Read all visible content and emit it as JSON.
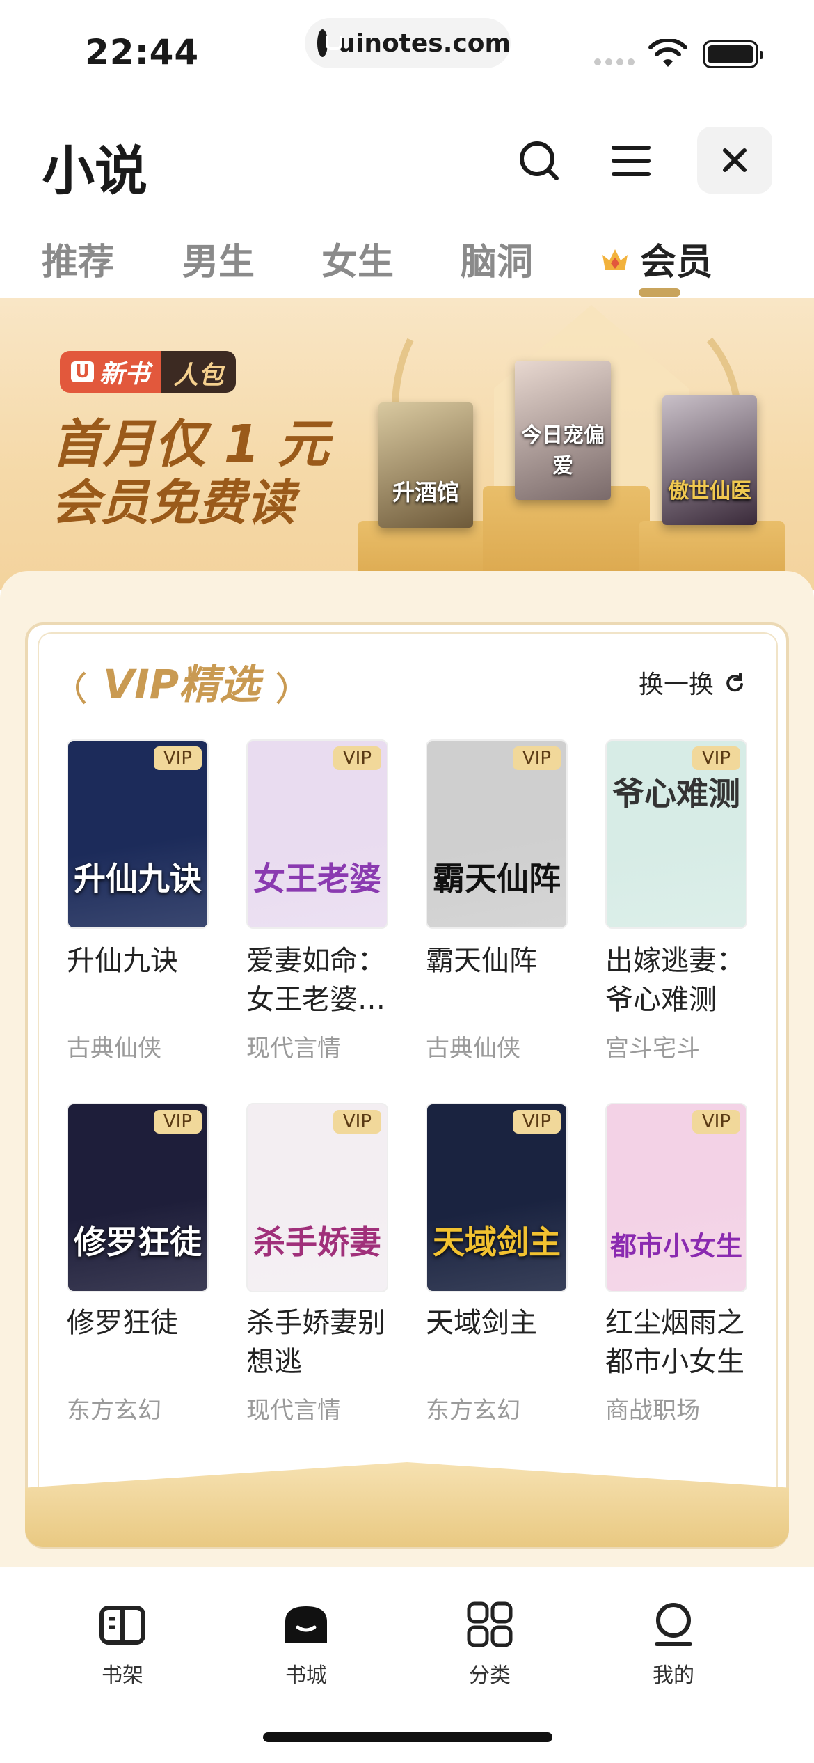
{
  "status_bar": {
    "time": "22:44",
    "url": "uinotes.com"
  },
  "header": {
    "title": "小说"
  },
  "tabs": [
    {
      "label": "推荐"
    },
    {
      "label": "男生"
    },
    {
      "label": "女生"
    },
    {
      "label": "脑洞"
    },
    {
      "label": "会员",
      "active": true
    }
  ],
  "banner": {
    "tag_new": "新书",
    "tag_pack": "人包",
    "line1": "首月仅 1 元",
    "line2": "会员免费读",
    "books": [
      "升酒馆",
      "今日宠偏爱",
      "傲世仙医"
    ]
  },
  "vip_section": {
    "title": "VIP精选",
    "refresh_label": "换一换",
    "badge": "VIP",
    "books": [
      {
        "title": "升仙九诀",
        "category": "古典仙侠",
        "cover_text": "升仙九诀",
        "cover_color": "#1c2b5a"
      },
      {
        "title": "爱妻如命：女王老婆…",
        "category": "现代言情",
        "cover_text": "女王老婆",
        "cover_color": "#e9dcf0"
      },
      {
        "title": "霸天仙阵",
        "category": "古典仙侠",
        "cover_text": "霸天仙阵",
        "cover_color": "#cfcfcf"
      },
      {
        "title": "出嫁逃妻：爷心难测",
        "category": "宫斗宅斗",
        "cover_text": "爷心难测",
        "cover_color": "#d7ece6"
      },
      {
        "title": "修罗狂徒",
        "category": "东方玄幻",
        "cover_text": "修罗狂徒",
        "cover_color": "#1e1e3a"
      },
      {
        "title": "杀手娇妻别想逃",
        "category": "现代言情",
        "cover_text": "杀手娇妻",
        "cover_color": "#f3eef2"
      },
      {
        "title": "天域剑主",
        "category": "东方玄幻",
        "cover_text": "天域剑主",
        "cover_color": "#1a2340"
      },
      {
        "title": "红尘烟雨之都市小女生",
        "category": "商战职场",
        "cover_text": "都市小女生",
        "cover_color": "#f3d2e6"
      }
    ]
  },
  "bottom_nav": [
    {
      "label": "书架",
      "icon": "book-open-icon"
    },
    {
      "label": "书城",
      "icon": "store-icon",
      "active": true
    },
    {
      "label": "分类",
      "icon": "grid-icon"
    },
    {
      "label": "我的",
      "icon": "profile-icon"
    }
  ]
}
